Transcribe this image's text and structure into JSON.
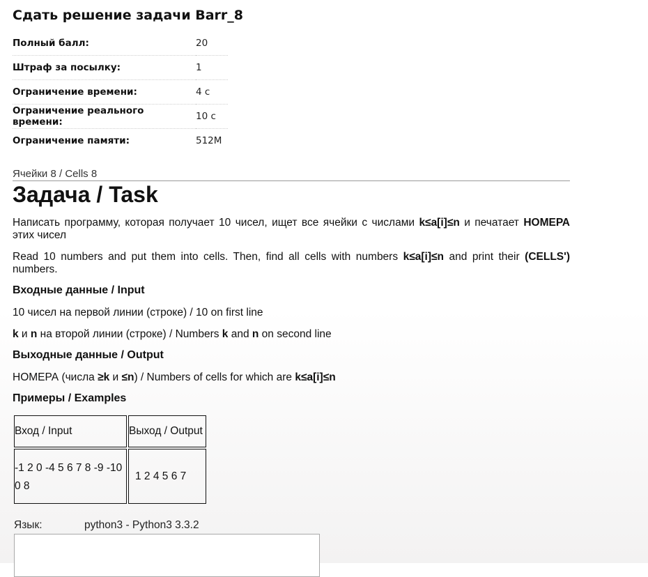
{
  "header": {
    "title": "Сдать решение задачи Barr_8"
  },
  "params": [
    {
      "label": "Полный балл:",
      "value": "20"
    },
    {
      "label": "Штраф за посылку:",
      "value": "1"
    },
    {
      "label": "Ограничение времени:",
      "value": "4 с"
    },
    {
      "label": "Ограничение реального времени:",
      "value": "10 с"
    },
    {
      "label": "Ограничение памяти:",
      "value": "512M"
    }
  ],
  "breadcrumb": "Ячейки 8 / Cells 8",
  "task": {
    "title": "Задача / Task",
    "ru_text_1": "Написать программу, которая получает 10 чисел, ищет все ячейки с числами ",
    "ru_cond": "k≤a[i]≤n",
    "ru_text_2": " и печатает ",
    "ru_bold_2": "НОМЕРА",
    "ru_text_3": " этих чисел",
    "en_text_1": "Read 10 numbers and put them into cells. Then, find all cells with numbers ",
    "en_cond": "k≤a[i]≤n",
    "en_text_2": " and print their ",
    "en_bold_2": "(CELLS')",
    "en_text_3": " numbers."
  },
  "input": {
    "heading": "Входные данные / Input",
    "line1": "10 чисел на первой линии (строке) / 10 on first line",
    "line2_k": "k",
    "line2_a": " и ",
    "line2_n": "n",
    "line2_b": " на второй линии (строке) / Numbers ",
    "line2_k2": "k",
    "line2_c": " and ",
    "line2_n2": "n",
    "line2_d": " on second line"
  },
  "output": {
    "heading": "Выходные данные / Output",
    "line_a": "НОМЕРА (числа ",
    "line_b": "≥k",
    "line_c": " и ",
    "line_d": "≤n",
    "line_e": ") / Numbers of cells for which are ",
    "line_f": "k≤a[i]≤n"
  },
  "examples": {
    "heading": "Примеры / Examples",
    "col_input": "Вход / Input",
    "col_output": "Выход / Output",
    "input_value": "-1 2 0 -4 5 6 7 8 -9 -10 0 8",
    "output_value": "1 2 4 5 6 7"
  },
  "submit": {
    "lang_label": "Язык:",
    "lang_value": "python3 - Python3 3.3.2",
    "code_value": ""
  }
}
